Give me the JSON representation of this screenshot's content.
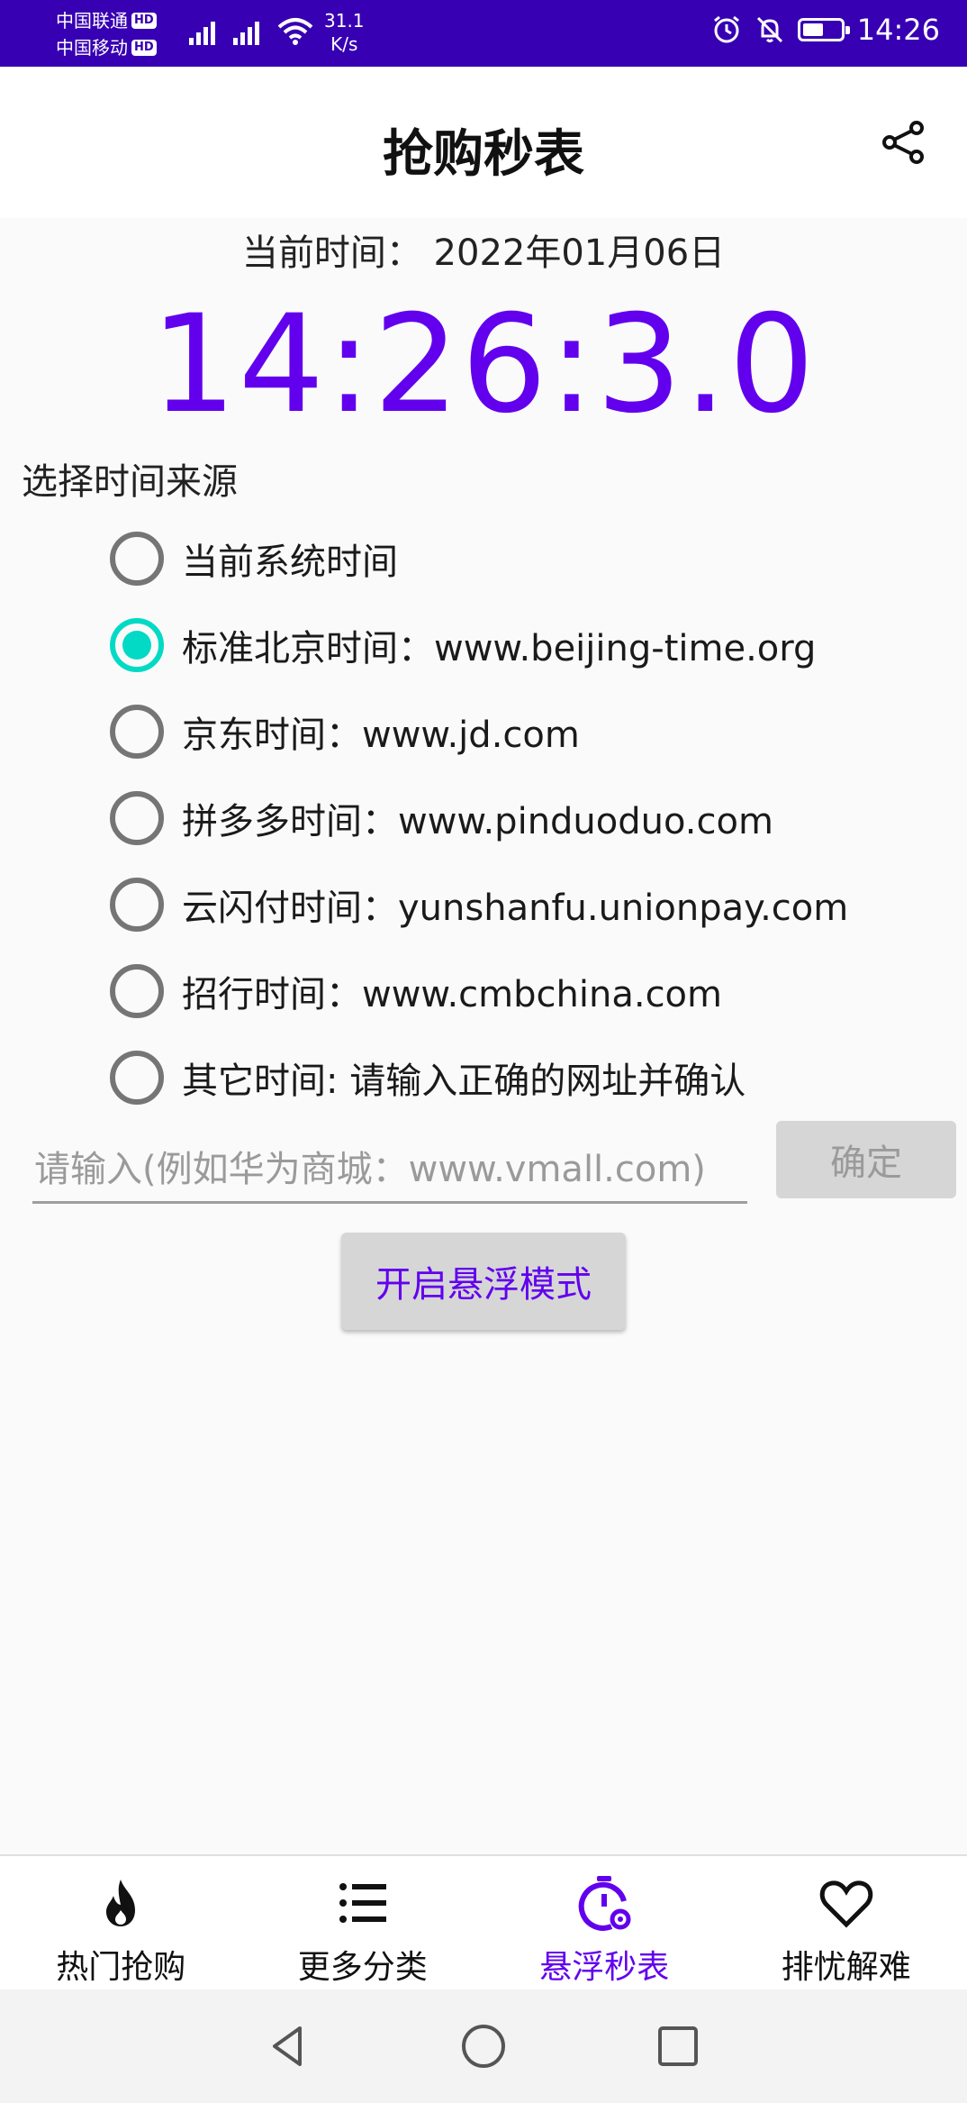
{
  "status_bar": {
    "carrier1": "中国联通",
    "carrier2": "中国移动",
    "hd_badge": "HD",
    "net_speed_value": "31.1",
    "net_speed_unit": "K/s",
    "time": "14:26"
  },
  "app_bar": {
    "title": "抢购秒表",
    "share_icon": "share-icon"
  },
  "clock_panel": {
    "date_line": "当前时间：  2022年01月06日",
    "clock": "14:26:3.0",
    "accent_color": "#6200ee"
  },
  "time_source": {
    "label": "选择时间来源",
    "options": [
      {
        "label": "当前系统时间",
        "checked": false
      },
      {
        "label": "标准北京时间：www.beijing-time.org",
        "checked": true
      },
      {
        "label": "京东时间：www.jd.com",
        "checked": false
      },
      {
        "label": "拼多多时间：www.pinduoduo.com",
        "checked": false
      },
      {
        "label": "云闪付时间：yunshanfu.unionpay.com",
        "checked": false
      },
      {
        "label": "招行时间：www.cmbchina.com",
        "checked": false
      },
      {
        "label": "其它时间: 请输入正确的网址并确认",
        "checked": false
      }
    ],
    "radio_checked_color": "#03dac5"
  },
  "custom_url": {
    "placeholder": "请输入(例如华为商城：www.vmall.com)",
    "value": "",
    "confirm_label": "确定"
  },
  "float_mode_button": "开启悬浮模式",
  "bottom_nav": {
    "items": [
      {
        "label": "热门抢购",
        "icon": "flame-icon",
        "active": false
      },
      {
        "label": "更多分类",
        "icon": "list-icon",
        "active": false
      },
      {
        "label": "悬浮秒表",
        "icon": "stopwatch-gear-icon",
        "active": true
      },
      {
        "label": "排忧解难",
        "icon": "heart-icon",
        "active": false
      }
    ]
  },
  "system_nav": {
    "back": "back-triangle-icon",
    "home": "home-circle-icon",
    "recents": "recents-square-icon"
  }
}
